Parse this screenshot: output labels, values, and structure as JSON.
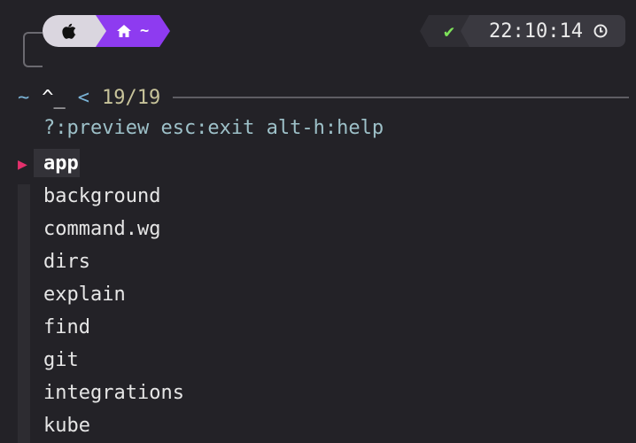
{
  "prompt": {
    "os_icon": "apple-icon",
    "home_icon": "home-icon",
    "directory": "~",
    "status_symbol": "✔",
    "time": "22:10:14",
    "clock_icon": "clock-icon"
  },
  "finder": {
    "tilde": "~",
    "cursor": "^_",
    "prompt_marker": "<",
    "count": "19/19",
    "help": "?:preview esc:exit alt-h:help",
    "pointer": "▶",
    "items": [
      "app",
      "background",
      "command.wg",
      "dirs",
      "explain",
      "find",
      "git",
      "integrations",
      "kube"
    ],
    "selected_index": 0
  },
  "colors": {
    "background": "#232227",
    "os_segment": "#dad6df",
    "dir_segment": "#8e3bf0",
    "status_ok": "#7ee25a",
    "pointer": "#e3306c"
  }
}
